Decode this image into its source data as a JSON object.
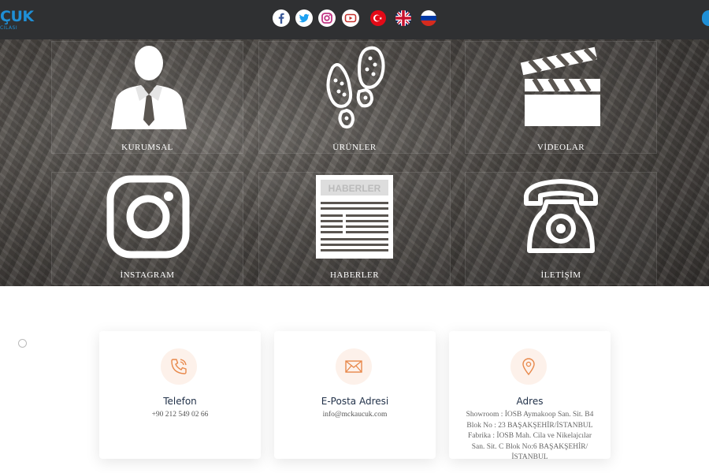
{
  "header": {
    "logo_text": "ÇUK",
    "logo_sub": "CILASI",
    "social": [
      {
        "name": "facebook-icon",
        "color": "#3b5998"
      },
      {
        "name": "twitter-icon",
        "color": "#1da1f2"
      },
      {
        "name": "instagram-icon",
        "color": "#c13584"
      },
      {
        "name": "youtube-icon",
        "color": "#c4302b"
      }
    ],
    "languages": [
      {
        "name": "flag-turkey-icon"
      },
      {
        "name": "flag-uk-icon"
      },
      {
        "name": "flag-russia-icon"
      }
    ]
  },
  "tiles": [
    {
      "key": "kurumsal",
      "label": "KURUMSAL",
      "icon": "businessman-icon"
    },
    {
      "key": "urunler",
      "label": "ÜRÜNLER",
      "icon": "footprints-icon"
    },
    {
      "key": "videolar",
      "label": "VİDEOLAR",
      "icon": "clapperboard-icon"
    },
    {
      "key": "instagram",
      "label": "İNSTAGRAM",
      "icon": "instagram-icon"
    },
    {
      "key": "haberler",
      "label": "HABERLER",
      "icon": "newspaper-icon",
      "icon_text": "HABERLER"
    },
    {
      "key": "iletisim",
      "label": "İLETİŞİM",
      "icon": "telephone-icon"
    }
  ],
  "contact": {
    "phone": {
      "title": "Telefon",
      "value": "+90 212 549 02 66",
      "icon": "phone-icon"
    },
    "email": {
      "title": "E-Posta Adresi",
      "value": "info@mckaucuk.com",
      "icon": "envelope-icon"
    },
    "address": {
      "title": "Adres",
      "icon": "location-pin-icon",
      "lines": [
        "Showroom : İOSB Aymakoop San. Sit. B4",
        "Blok No : 23 BAŞAKŞEHİR/İSTANBUL",
        "Fabrika : İOSB Mah. Cila ve Nikelajcılar",
        "San. Sit. C Blok No:6 BAŞAKŞEHİR/",
        "İSTANBUL"
      ]
    }
  },
  "colors": {
    "accent": "#1f8fd6",
    "icon_orange": "#e8884a",
    "header_bg": "#2f3032"
  }
}
